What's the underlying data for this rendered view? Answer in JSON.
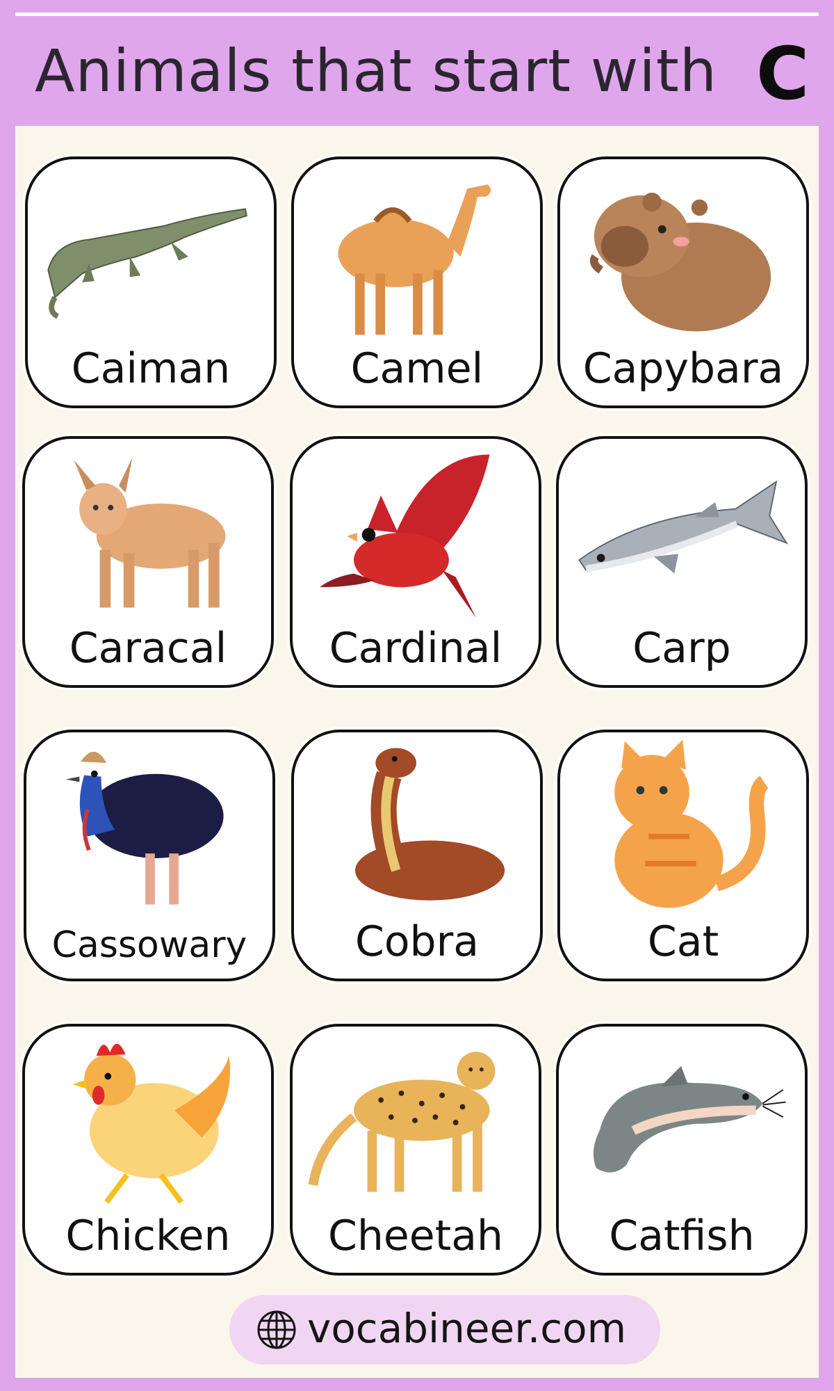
{
  "header": {
    "title": "Animals that start with",
    "letter": "C"
  },
  "animals": [
    {
      "name": "Caiman",
      "icon": "caiman-icon"
    },
    {
      "name": "Camel",
      "icon": "camel-icon"
    },
    {
      "name": "Capybara",
      "icon": "capybara-icon"
    },
    {
      "name": "Caracal",
      "icon": "caracal-icon"
    },
    {
      "name": "Cardinal",
      "icon": "cardinal-icon"
    },
    {
      "name": "Carp",
      "icon": "carp-icon"
    },
    {
      "name": "Cassowary",
      "icon": "cassowary-icon"
    },
    {
      "name": "Cobra",
      "icon": "cobra-icon"
    },
    {
      "name": "Cat",
      "icon": "cat-icon"
    },
    {
      "name": "Chicken",
      "icon": "chicken-icon"
    },
    {
      "name": "Cheetah",
      "icon": "cheetah-icon"
    },
    {
      "name": "Catfish",
      "icon": "catfish-icon"
    }
  ],
  "footer": {
    "site": "vocabineer.com",
    "icon": "globe-icon"
  },
  "colors": {
    "background": "#e0a6ec",
    "panel": "#fbf6ec",
    "pill": "#f1d6f3"
  }
}
